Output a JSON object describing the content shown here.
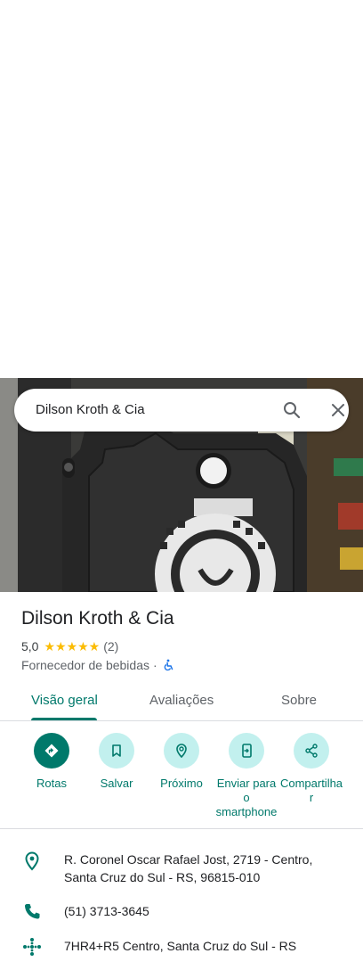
{
  "search": {
    "query": "Dilson Kroth & Cia"
  },
  "place": {
    "name": "Dilson Kroth & Cia",
    "rating": "5,0",
    "stars": "★★★★★",
    "review_count": "(2)",
    "category": "Fornecedor de bebidas",
    "separator": "·"
  },
  "tabs": [
    {
      "label": "Visão geral",
      "active": true
    },
    {
      "label": "Avaliações",
      "active": false
    },
    {
      "label": "Sobre",
      "active": false
    }
  ],
  "actions": [
    {
      "label": "Rotas",
      "icon": "directions-icon"
    },
    {
      "label": "Salvar",
      "icon": "bookmark-icon"
    },
    {
      "label": "Próximo",
      "icon": "nearby-icon"
    },
    {
      "label": "Enviar para o smartphone",
      "icon": "send-to-phone-icon"
    },
    {
      "label": "Compartilhar",
      "icon": "share-icon"
    }
  ],
  "info": {
    "address": "R. Coronel Oscar Rafael Jost, 2719 - Centro, Santa Cruz do Sul - RS, 96815-010",
    "phone": "(51) 3713-3645",
    "plus_code": "7HR4+R5 Centro, Santa Cruz do Sul - RS"
  },
  "colors": {
    "accent": "#00796b",
    "accent_light": "#c2f0ee",
    "star": "#fbbc04"
  }
}
